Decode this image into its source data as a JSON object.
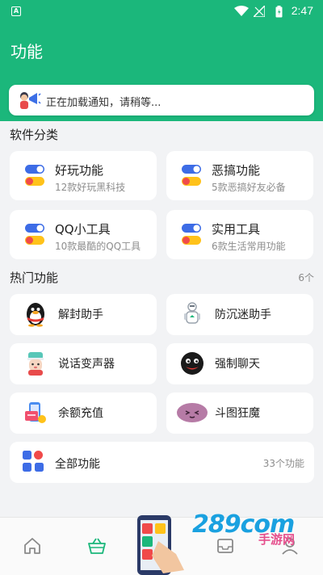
{
  "status_bar": {
    "time": "2:47"
  },
  "header": {
    "title": "功能"
  },
  "notice": {
    "text": "正在加载通知，请稍等..."
  },
  "categories": {
    "title": "软件分类",
    "items": [
      {
        "name": "好玩功能",
        "desc": "12款好玩黑科技"
      },
      {
        "name": "恶搞功能",
        "desc": "5款恶搞好友必备"
      },
      {
        "name": "QQ小工具",
        "desc": "10款最酷的QQ工具"
      },
      {
        "name": "实用工具",
        "desc": "6款生活常用功能"
      }
    ]
  },
  "hot": {
    "title": "热门功能",
    "count": "6个",
    "items": [
      {
        "name": "解封助手",
        "icon": "qq-penguin-icon"
      },
      {
        "name": "防沉迷助手",
        "icon": "robot-icon"
      },
      {
        "name": "说话变声器",
        "icon": "character-icon"
      },
      {
        "name": "强制聊天",
        "icon": "qq-face-icon"
      },
      {
        "name": "余额充值",
        "icon": "wallet-icon"
      },
      {
        "name": "斗图狂魔",
        "icon": "blob-face-icon"
      }
    ]
  },
  "all": {
    "name": "全部功能",
    "count": "33个功能"
  },
  "watermark": {
    "main": "289com",
    "sub": "手游网"
  },
  "colors": {
    "accent": "#1bb77b",
    "toggle_blue": "#3d6ce6",
    "toggle_red": "#f04a4a",
    "toggle_yellow": "#ffc21a"
  }
}
